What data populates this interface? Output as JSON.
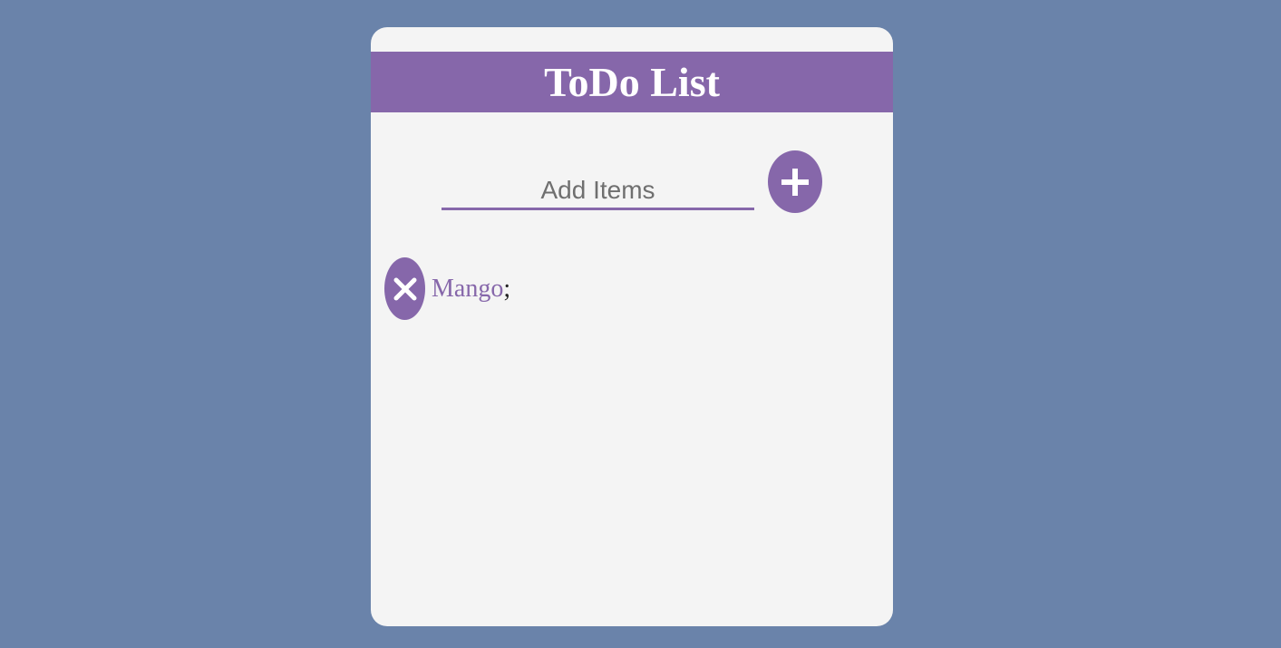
{
  "app": {
    "title": "ToDo List"
  },
  "add_form": {
    "input_value": "",
    "input_placeholder": "Add Items",
    "add_button_icon": "plus-icon"
  },
  "items": [
    {
      "text": "Mango",
      "suffix": ";",
      "delete_icon": "close-icon"
    }
  ],
  "colors": {
    "page_background": "#6a83aa",
    "card_background": "#f4f4f4",
    "accent": "#8667aa",
    "title_text": "#ffffff",
    "placeholder_text": "#6f6f6f"
  }
}
